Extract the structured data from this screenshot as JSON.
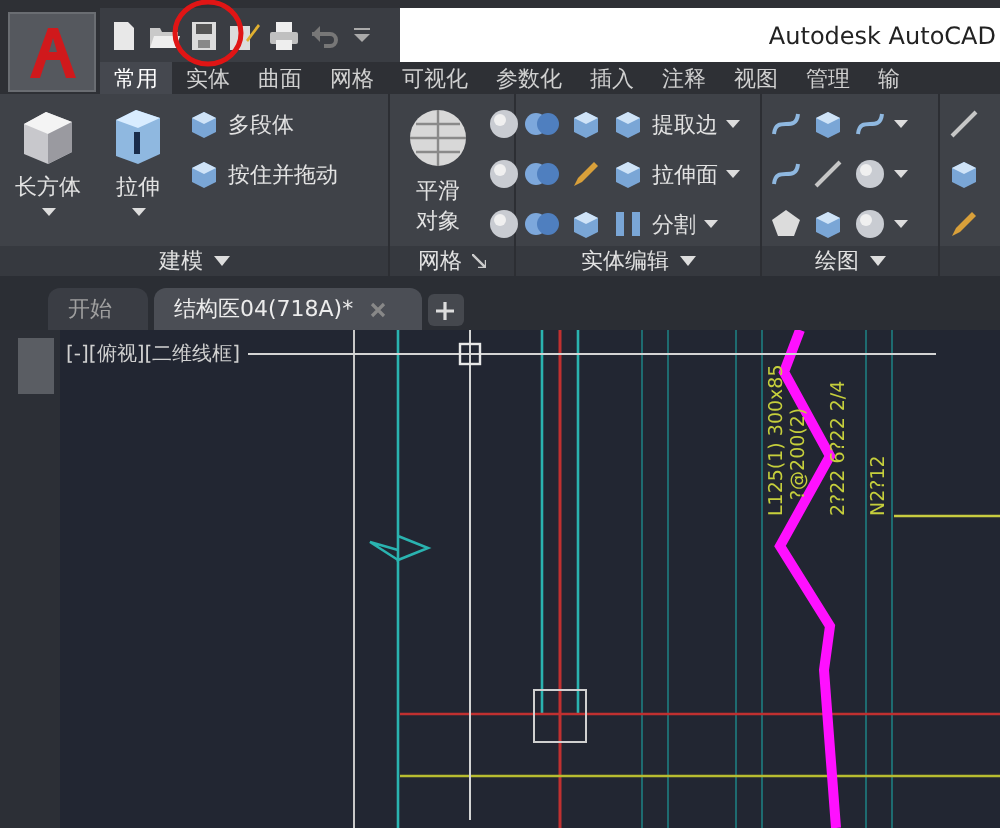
{
  "title_bar": {
    "title": "Autodesk AutoCAD"
  },
  "ribbon_tabs": [
    {
      "label": "常用",
      "selected": true
    },
    {
      "label": "实体",
      "selected": false
    },
    {
      "label": "曲面",
      "selected": false
    },
    {
      "label": "网格",
      "selected": false
    },
    {
      "label": "可视化",
      "selected": false
    },
    {
      "label": "参数化",
      "selected": false
    },
    {
      "label": "插入",
      "selected": false
    },
    {
      "label": "注释",
      "selected": false
    },
    {
      "label": "视图",
      "selected": false
    },
    {
      "label": "管理",
      "selected": false
    },
    {
      "label": "输",
      "selected": false
    }
  ],
  "panels": [
    {
      "title": "建模",
      "launcher": false,
      "columns": [
        {
          "kind": "large",
          "label": "长方体",
          "dropdown": true
        },
        {
          "kind": "large",
          "label": "拉伸",
          "dropdown": true
        },
        {
          "kind": "stack",
          "items": [
            {
              "label": "多段体",
              "dropdown": false
            },
            {
              "label": "按住并拖动",
              "dropdown": false
            }
          ]
        }
      ]
    },
    {
      "title": "网格",
      "launcher": true,
      "columns": [
        {
          "kind": "large",
          "label": "平滑对象",
          "dropdown": false
        },
        {
          "kind": "stack",
          "items": [
            {
              "dropdown": false
            },
            {
              "dropdown": false
            },
            {
              "dropdown": false
            }
          ]
        }
      ]
    },
    {
      "title": "实体编辑",
      "launcher": false,
      "columns": [
        {
          "kind": "stack",
          "items": [
            {
              "dropdown": false
            },
            {
              "dropdown": false
            },
            {
              "dropdown": false
            }
          ]
        },
        {
          "kind": "stack",
          "items": [
            {
              "dropdown": false
            },
            {
              "dropdown": false
            },
            {
              "dropdown": false
            }
          ]
        },
        {
          "kind": "stack",
          "items": [
            {
              "label": "提取边",
              "dropdown": true
            },
            {
              "label": "拉伸面",
              "dropdown": true
            },
            {
              "label": "分割",
              "dropdown": true
            }
          ]
        }
      ]
    },
    {
      "title": "绘图",
      "launcher": false,
      "columns": [
        {
          "kind": "stack",
          "items": [
            {
              "dropdown": false
            },
            {
              "dropdown": false
            },
            {
              "dropdown": false
            }
          ]
        },
        {
          "kind": "stack",
          "items": [
            {
              "dropdown": false
            },
            {
              "dropdown": false
            },
            {
              "dropdown": false
            }
          ]
        },
        {
          "kind": "stack",
          "items": [
            {
              "dropdown": true
            },
            {
              "dropdown": true
            },
            {
              "dropdown": true
            }
          ]
        }
      ]
    },
    {
      "columns": [
        {
          "kind": "stack",
          "items": [
            {
              "dropdown": false
            },
            {
              "dropdown": false
            },
            {
              "dropdown": false
            }
          ]
        }
      ]
    }
  ],
  "file_tabs": [
    {
      "label": "开始",
      "selected": false,
      "closable": false
    },
    {
      "label": "结构医04(718A)*",
      "selected": true,
      "closable": true
    }
  ],
  "viewport": {
    "label": "[-][俯视][二维线框]"
  },
  "drawing_labels": [
    "L125(1) 300x85",
    "?@200(2)",
    "2?22 6?22 2/4",
    "N2?12"
  ]
}
